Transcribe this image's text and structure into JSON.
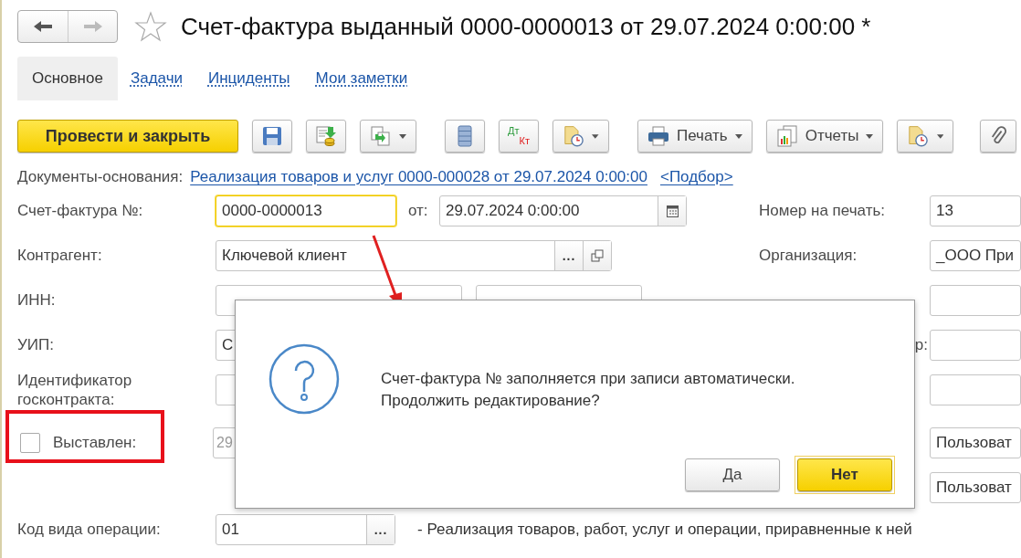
{
  "nav": {
    "back_disabled": false,
    "forward_disabled": true
  },
  "favorite": false,
  "title": "Счет-фактура выданный 0000-0000013 от 29.07.2024 0:00:00 *",
  "tabs": [
    {
      "label": "Основное",
      "selected": true
    },
    {
      "label": "Задачи",
      "selected": false
    },
    {
      "label": "Инциденты",
      "selected": false
    },
    {
      "label": "Мои заметки",
      "selected": false
    }
  ],
  "toolbar": {
    "primary": "Провести и закрыть",
    "dt": "Дт",
    "kt": "Кт",
    "print": "Печать",
    "reports": "Отчеты"
  },
  "base_docs": {
    "label": "Документы-основания:",
    "link": "Реализация товаров и услуг 0000-000028 от 29.07.2024 0:00:00",
    "pick": "<Подбор>"
  },
  "invoice_number": {
    "label": "Счет-фактура №:",
    "value": "0000-0000013",
    "focused": true
  },
  "date": {
    "label": "от:",
    "value": "29.07.2024  0:00:00"
  },
  "print_number": {
    "label": "Номер на печать:",
    "value": "13"
  },
  "counterparty": {
    "label": "Контрагент:",
    "value": "Ключевой клиент",
    "select_button": "..."
  },
  "organization": {
    "label": "Организация:",
    "value": "_ООО При"
  },
  "inn": {
    "label": "ИНН:"
  },
  "uip": {
    "label": "УИП:",
    "value": "С"
  },
  "row_4_right": {
    "label": "р:"
  },
  "contract_id": {
    "label": "Идентификатор госконтракта:"
  },
  "issued": {
    "label": "Выставлен:",
    "checked": false,
    "highlighted": true,
    "date": "29",
    "date_disabled": true
  },
  "row_6_right": {
    "value": "Пользоват"
  },
  "row_7_right": {
    "value": "Пользоват"
  },
  "operation_code": {
    "label": "Код вида операции:",
    "value": "01",
    "select_button": "...",
    "description": "- Реализация товаров, работ, услуг и операции, приравненные к ней"
  },
  "dialog": {
    "lines": [
      "Счет-фактура № заполняется при записи автоматически.",
      "Продолжить редактирование?"
    ],
    "buttons": [
      {
        "label": "Да",
        "default": false
      },
      {
        "label": "Нет",
        "default": true
      }
    ]
  }
}
